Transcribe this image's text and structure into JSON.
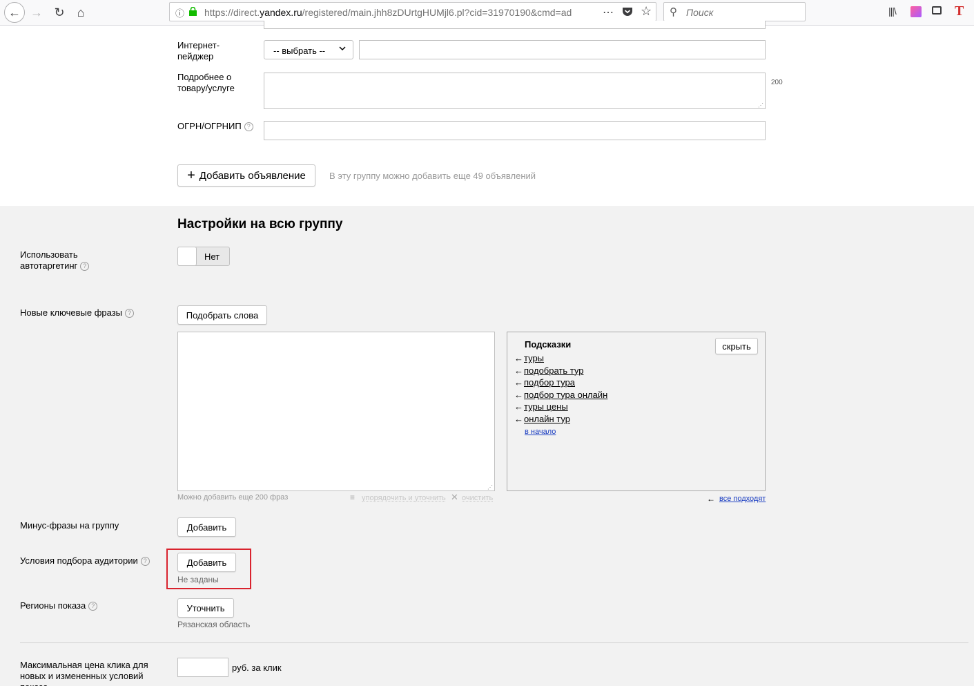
{
  "browser": {
    "url": "https://direct.yandex.ru/registered/main.jhh8zDUrtgHUMjl6.pl?cid=31970190&cmd=ad",
    "url_domain_prefix": "https://direct.",
    "url_domain": "yandex.ru",
    "url_rest": "/registered/main.jhh8zDUrtgHUMjl6.pl?cid=31970190&cmd=ad",
    "search_placeholder": "Поиск"
  },
  "ad_form": {
    "pager_label": "Интернет-\nпейджер",
    "pager_select": "-- выбрать --",
    "details_label": "Подробнее о\nтовару/услуге",
    "details_counter": "200",
    "ogrn_label": "ОГРН/ОГРНИП",
    "add_ad_button": "Добавить объявление",
    "add_ad_hint": "В эту группу можно добавить еще 49 объявлений"
  },
  "group_settings": {
    "title": "Настройки на всю группу",
    "autotargeting_label": "Использовать автотаргетинг",
    "autotargeting_value": "Нет",
    "keywords_label": "Новые ключевые фразы",
    "pick_words_button": "Подобрать слова",
    "keywords_counter": "Можно добавить еще 200 фраз",
    "sort_refine": "упорядочить и уточнить",
    "clear": "очистить",
    "suggestions_title": "Подсказки",
    "hide_button": "скрыть",
    "suggestions": [
      "туры",
      "подобрать тур",
      "подбор тура",
      "подбор тура онлайн",
      "туры цены",
      "онлайн тур"
    ],
    "to_start": "в начало",
    "all_fit": "все подходят",
    "minus_label": "Минус-фразы на группу",
    "minus_button": "Добавить",
    "audience_label": "Условия подбора аудитории",
    "audience_button": "Добавить",
    "audience_status": "Не заданы",
    "regions_label": "Регионы показа",
    "regions_button": "Уточнить",
    "regions_value": "Рязанская область",
    "max_price_label": "Максимальная цена клика для новых и измененных условий показа",
    "price_unit": "руб. за клик"
  },
  "colors": {
    "highlight": "#d9232e",
    "link": "#1a3dc1",
    "gray_section": "#f2f2f2"
  }
}
